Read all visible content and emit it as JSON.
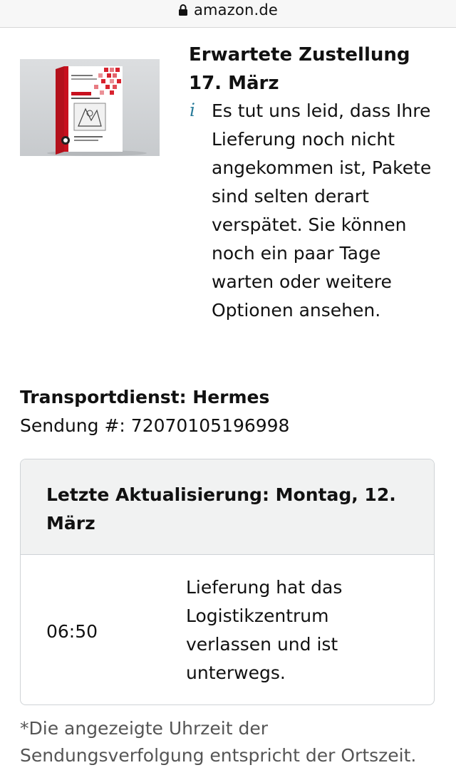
{
  "browser": {
    "url": "amazon.de",
    "lock_icon": "lock-icon"
  },
  "product": {
    "image_icon": "book-cover-image"
  },
  "delivery": {
    "title": "Erwartete Zustellung 17. März",
    "info_icon_glyph": "i",
    "message": "Es tut uns leid, dass Ihre Lieferung noch nicht angekommen ist, Pakete sind selten derart verspätet. Sie können noch ein paar Tage warten oder weitere Optionen ansehen."
  },
  "shipping": {
    "carrier_line": "Transportdienst: Hermes",
    "tracking_line": "Sendung #: 72070105196998"
  },
  "tracking": {
    "last_update": "Letzte Aktualisierung: Montag, 12. März",
    "events": [
      {
        "time": "06:50",
        "status": "Lieferung hat das Logistikzentrum verlassen und ist unterwegs."
      }
    ]
  },
  "footnote": "*Die angezeigte Uhrzeit der Sendungsverfolgung entspricht der Ortszeit."
}
